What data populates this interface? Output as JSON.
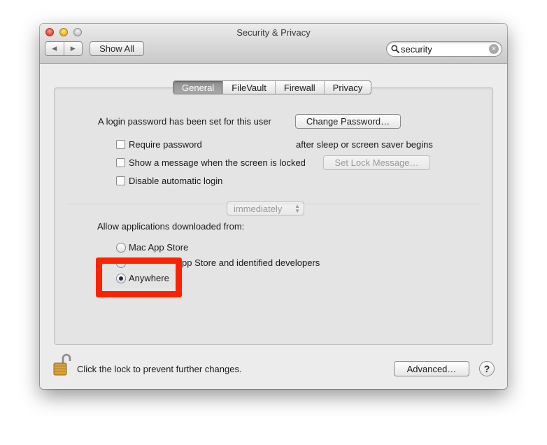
{
  "window": {
    "title": "Security & Privacy"
  },
  "toolbar": {
    "back_glyph": "◀",
    "forward_glyph": "▶",
    "show_all_label": "Show All",
    "search_value": "security",
    "clear_glyph": "×"
  },
  "tabs": [
    {
      "label": "General",
      "selected": true
    },
    {
      "label": "FileVault"
    },
    {
      "label": "Firewall"
    },
    {
      "label": "Privacy"
    }
  ],
  "general": {
    "login_password_text": "A login password has been set for this user",
    "change_password_label": "Change Password…",
    "require_password_label": "Require password",
    "require_password_checked": false,
    "require_password_delay": "immediately",
    "require_password_suffix": "after sleep or screen saver begins",
    "show_message_label": "Show a message when the screen is locked",
    "show_message_checked": false,
    "set_lock_message_label": "Set Lock Message…",
    "disable_autologin_label": "Disable automatic login",
    "disable_autologin_checked": false,
    "allow_apps_heading": "Allow applications downloaded from:",
    "app_sources": [
      {
        "label": "Mac App Store",
        "selected": false
      },
      {
        "label": "Mac App Store and identified developers",
        "visible_part": "pp Store and identified developers",
        "selected": false
      },
      {
        "label": "Anywhere",
        "selected": true
      }
    ]
  },
  "footer": {
    "lock_text": "Click the lock to prevent further changes.",
    "advanced_label": "Advanced…",
    "help_glyph": "?"
  },
  "colors": {
    "highlight": "#ff2200",
    "selected_tab": "#9a9a9a"
  }
}
